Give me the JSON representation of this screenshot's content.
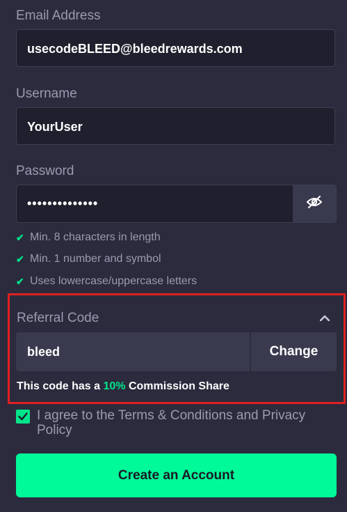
{
  "email": {
    "label": "Email Address",
    "value": "usecodeBLEED@bleedrewards.com"
  },
  "username": {
    "label": "Username",
    "value": "YourUser"
  },
  "password": {
    "label": "Password",
    "masked_value": "••••••••••••••",
    "toggle_icon": "eye-off-icon"
  },
  "password_rules": [
    {
      "text": "Min. 8 characters in length",
      "met": true
    },
    {
      "text": "Min. 1 number and symbol",
      "met": true
    },
    {
      "text": "Uses lowercase/uppercase letters",
      "met": true
    }
  ],
  "referral": {
    "label": "Referral Code",
    "value": "bleed",
    "change_label": "Change",
    "commission_prefix": "This code has a ",
    "commission_percent": "10%",
    "commission_suffix": " Commission Share"
  },
  "terms": {
    "text": "I agree to the Terms & Conditions and Privacy Policy",
    "checked": true
  },
  "create_button": {
    "label": "Create an Account"
  },
  "colors": {
    "background": "#2b2b3d",
    "input_bg": "#1f1f2e",
    "accent": "#00fa99",
    "highlight_border": "#e02020"
  }
}
